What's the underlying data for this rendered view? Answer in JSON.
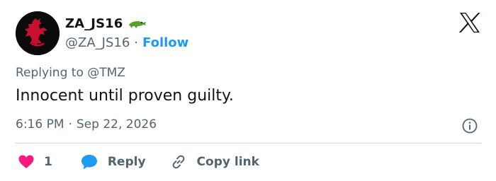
{
  "user": {
    "display_name": "ZA_JS16",
    "handle": "@ZA_JS16",
    "separator": "·",
    "follow_label": "Follow",
    "emoji_icon": "crocodile-emoji",
    "avatar_icon": "liverbird-crest"
  },
  "brand": {
    "logo_icon": "x-logo"
  },
  "tweet": {
    "replying_to_label": "Replying to",
    "replying_to_handle": "@TMZ",
    "text": "Innocent until proven guilty.",
    "time": "6:16 PM",
    "separator": "·",
    "date": "Sep 22, 2026"
  },
  "actions": {
    "like_count": "1",
    "reply_label": "Reply",
    "copy_link_label": "Copy link"
  },
  "colors": {
    "accent": "#1d9bf0",
    "like": "#f91880",
    "muted_text": "#536471",
    "text": "#0f1419",
    "divider": "#cfd9de"
  }
}
